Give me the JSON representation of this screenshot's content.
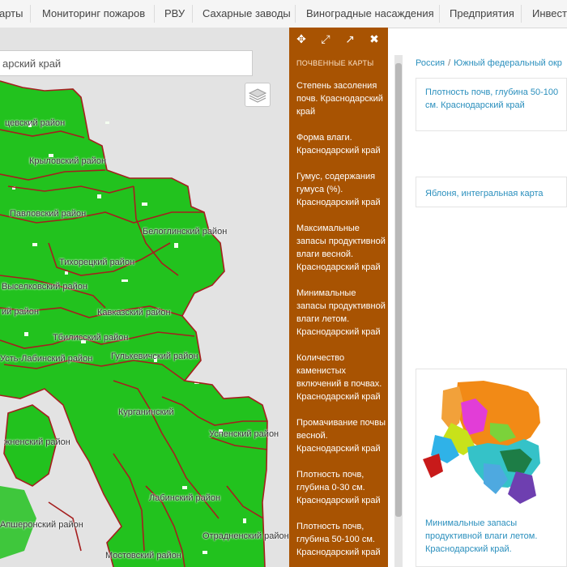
{
  "nav": {
    "items": [
      "арты",
      "Мониторинг пожаров",
      "РВУ",
      "Сахарные заводы",
      "Виноградные насаждения",
      "Предприятия",
      "Инвест"
    ]
  },
  "search": {
    "value": "арский край"
  },
  "map": {
    "region_labels": [
      "цевский район",
      "Крыловский район",
      "Павловский район",
      "Белоглинский район",
      "Тихорецкий район",
      "Выселковский район",
      "ий район",
      "Кавказский район",
      "Тбилисский район",
      "Гулькевичский район",
      "Усть-Лабинский район",
      "Курганинский",
      "жненский район",
      "Успенский район",
      "Отрадненский район",
      "Лабинский район",
      "Мостовский район",
      "Апшеронский район"
    ],
    "colors": {
      "fill": "#22c21e",
      "border": "#a51f1f",
      "water": "#e3e3e3"
    }
  },
  "panel": {
    "tools": [
      "move-icon",
      "fullscreen-icon",
      "external-link-icon",
      "close-icon"
    ],
    "heading": "ПОЧВЕННЫЕ КАРТЫ",
    "items": [
      "Степень засоления почв. Краснодарский край",
      "Форма влаги. Краснодарский край",
      "Гумус, содержания гумуса (%). Краснодарский край",
      "Максимальные запасы продуктивной влаги весной. Краснодарский край",
      "Минимальные запасы продуктивной влаги летом. Краснодарский край",
      "Количество каменистых включений в почвах. Краснодарский край",
      "Промачивание почвы весной. Краснодарский край",
      "Плотность почв, глубина 0-30 см. Краснодарский край",
      "Плотность почв, глубина 50-100 см. Краснодарский край"
    ],
    "color": "#a85302"
  },
  "breadcrumb": {
    "items": [
      "Россия",
      "Южный федеральный окр"
    ]
  },
  "cards": [
    {
      "title": "Плотность почв, глубина 50-100 см. Краснодарский край"
    },
    {
      "title": "Яблоня, интегральная карта"
    },
    {
      "title": "Минимальные запасы продуктивной влаги летом. Краснодарский край."
    }
  ],
  "link_color": "#2a8fbd"
}
